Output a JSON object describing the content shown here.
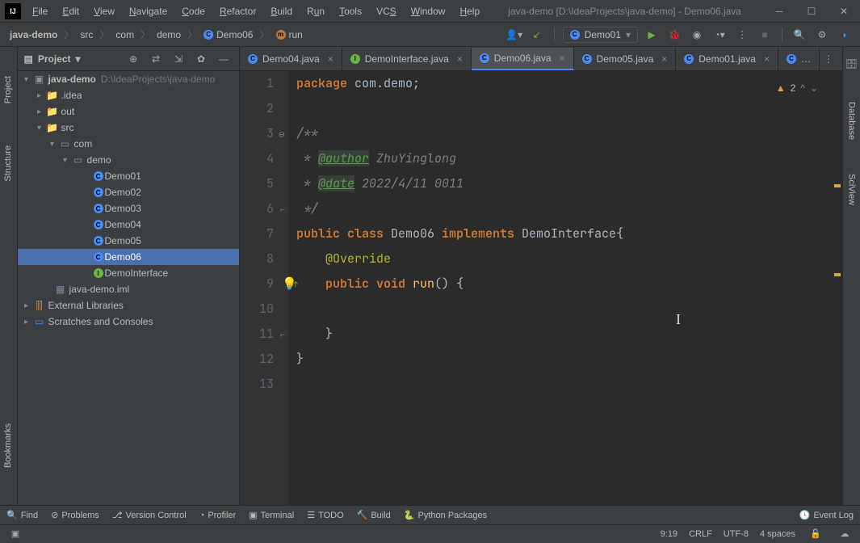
{
  "window": {
    "title": "java-demo [D:\\IdeaProjects\\java-demo] - Demo06.java"
  },
  "menu": [
    "File",
    "Edit",
    "View",
    "Navigate",
    "Code",
    "Refactor",
    "Build",
    "Run",
    "Tools",
    "VCS",
    "Window",
    "Help"
  ],
  "breadcrumb": {
    "project": "java-demo",
    "src": "src",
    "com": "com",
    "demo": "demo",
    "class": "Demo06",
    "method": "run"
  },
  "runconfig": "Demo01",
  "project_panel": {
    "title": "Project",
    "root": "java-demo",
    "root_path": "D:\\IdeaProjects\\java-demo",
    "idea": ".idea",
    "out": "out",
    "src": "src",
    "com": "com",
    "demo": "demo",
    "classes": [
      "Demo01",
      "Demo02",
      "Demo03",
      "Demo04",
      "Demo05",
      "Demo06",
      "DemoInterface"
    ],
    "iml": "java-demo.iml",
    "external": "External Libraries",
    "scratches": "Scratches and Consoles"
  },
  "tabs": [
    {
      "name": "Demo04.java",
      "active": false
    },
    {
      "name": "DemoInterface.java",
      "active": false
    },
    {
      "name": "Demo06.java",
      "active": true
    },
    {
      "name": "Demo05.java",
      "active": false
    },
    {
      "name": "Demo01.java",
      "active": false
    }
  ],
  "editor": {
    "warnings": "2",
    "lines": {
      "l1": "package com.demo;",
      "l3": "/**",
      "l4a": " * ",
      "l4tag": "@author",
      "l4b": " ZhuYinglong",
      "l5a": " * ",
      "l5tag": "@date",
      "l5b": " 2022/4/11 0011",
      "l6": " */",
      "l7a": "public class ",
      "l7b": "Demo06 ",
      "l7c": "implements ",
      "l7d": "DemoInterface{",
      "l8": "    @Override",
      "l9a": "    public void ",
      "l9b": "run",
      "l9c": "() {",
      "l11": "    }",
      "l12": "}"
    }
  },
  "bottom": {
    "find": "Find",
    "problems": "Problems",
    "vcs": "Version Control",
    "profiler": "Profiler",
    "terminal": "Terminal",
    "todo": "TODO",
    "build": "Build",
    "python": "Python Packages",
    "eventlog": "Event Log"
  },
  "status": {
    "pos": "9:19",
    "eol": "CRLF",
    "enc": "UTF-8",
    "indent": "4 spaces"
  },
  "side": {
    "project": "Project",
    "structure": "Structure",
    "bookmarks": "Bookmarks",
    "database": "Database",
    "sciview": "SciView"
  }
}
